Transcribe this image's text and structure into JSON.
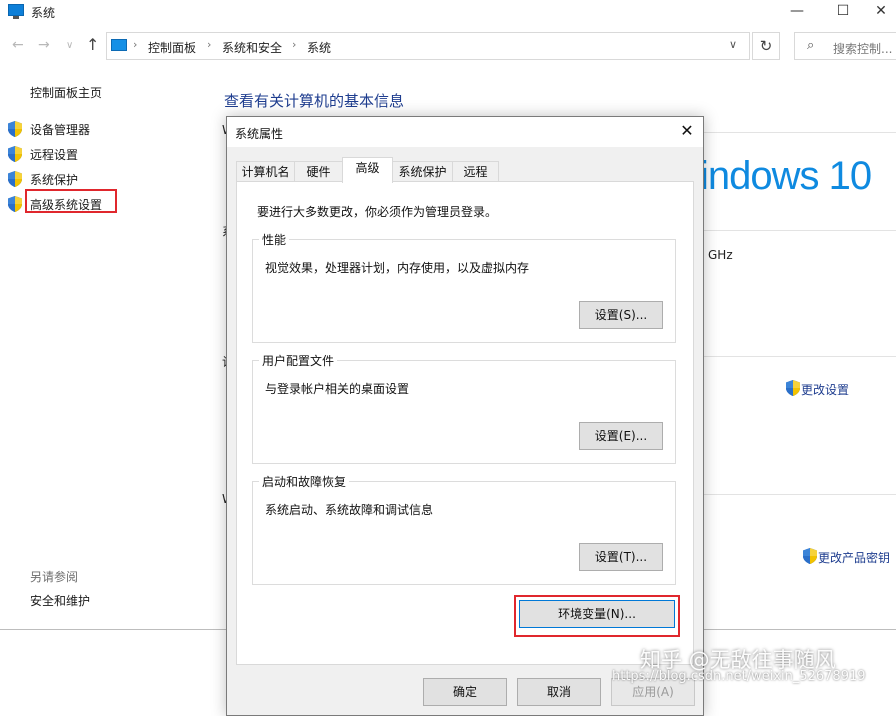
{
  "window": {
    "title": "系统",
    "minimize_glyph": "—",
    "maximize_glyph": "☐",
    "close_glyph": "✕"
  },
  "address": {
    "back_glyph": "←",
    "forward_glyph": "→",
    "recent_glyph": "∨",
    "up_glyph": "↑",
    "crumbs": [
      "控制面板",
      "系统和安全",
      "系统"
    ],
    "sep_glyph": "›",
    "dropdown_glyph": "∨",
    "refresh_glyph": "↻",
    "search_icon": "⌕",
    "search_placeholder": "搜索控制..."
  },
  "sidebar": {
    "home": "控制面板主页",
    "items": [
      {
        "label": "设备管理器",
        "icon": "uac-shield-icon"
      },
      {
        "label": "远程设置",
        "icon": "uac-shield-icon"
      },
      {
        "label": "系统保护",
        "icon": "uac-shield-icon"
      },
      {
        "label": "高级系统设置",
        "icon": "uac-shield-icon"
      }
    ],
    "see_also": "另请参阅",
    "security_maintenance": "安全和维护"
  },
  "content": {
    "title": "查看有关计算机的基本信息",
    "windows_logo_text": "indows 10",
    "cpu_suffix": "GHz",
    "change_settings": "更改设置",
    "change_product_key": "更改产品密钥",
    "stray_chars": [
      "W",
      "系",
      "计",
      "W"
    ]
  },
  "dialog": {
    "title": "系统属性",
    "close_glyph": "✕",
    "tabs": [
      "计算机名",
      "硬件",
      "高级",
      "系统保护",
      "远程"
    ],
    "active_tab": "高级",
    "admin_note": "要进行大多数更改，你必须作为管理员登录。",
    "groups": [
      {
        "title": "性能",
        "desc": "视觉效果，处理器计划，内存使用，以及虚拟内存",
        "button": "设置(S)..."
      },
      {
        "title": "用户配置文件",
        "desc": "与登录帐户相关的桌面设置",
        "button": "设置(E)..."
      },
      {
        "title": "启动和故障恢复",
        "desc": "系统启动、系统故障和调试信息",
        "button": "设置(T)..."
      }
    ],
    "env_button": "环境变量(N)...",
    "ok": "确定",
    "cancel": "取消",
    "apply": "应用(A)"
  },
  "watermark": {
    "text": "知乎 @无敌往事随风",
    "url": "https://blog.csdn.net/weixin_52678919"
  },
  "colors": {
    "highlight_red": "#e0272d",
    "link_blue": "#1e3d8f",
    "win_blue": "#0f8ae0",
    "focus_blue": "#0078d7"
  }
}
